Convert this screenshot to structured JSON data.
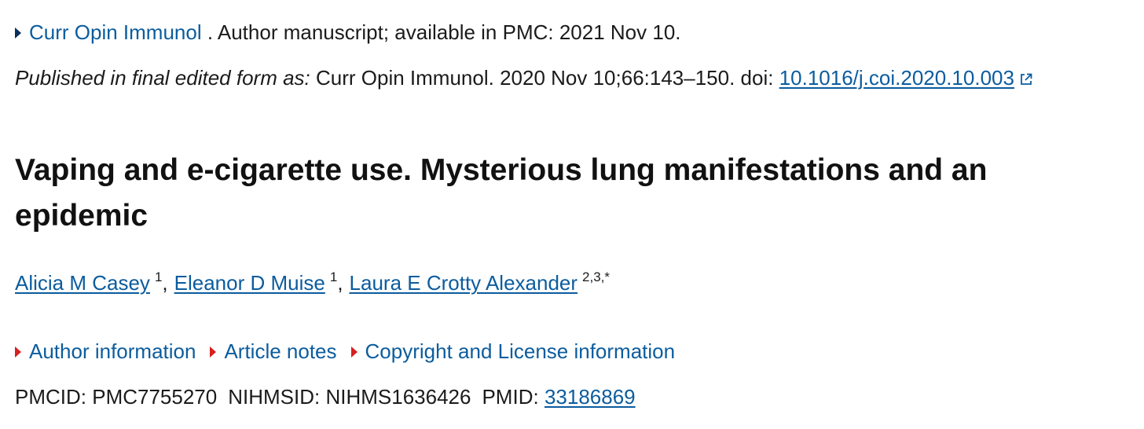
{
  "journal_line": {
    "journal_link": "Curr Opin Immunol",
    "rest": ". Author manuscript; available in PMC: 2021 Nov 10."
  },
  "published_line": {
    "italic_prefix": "Published in final edited form as:",
    "citation": " Curr Opin Immunol. 2020 Nov 10;66:143–150. doi: ",
    "doi_link": "10.1016/j.coi.2020.10.003",
    "external_icon": "external-link-icon"
  },
  "article": {
    "title": "Vaping and e-cigarette use. Mysterious lung manifestations and an epidemic"
  },
  "authors": [
    {
      "name": "Alicia M Casey",
      "sup": "1",
      "sep": ","
    },
    {
      "name": "Eleanor D Muise",
      "sup": "1",
      "sep": ","
    },
    {
      "name": "Laura E Crotty Alexander",
      "sup": "2,3,*",
      "sep": ""
    }
  ],
  "accordions": [
    {
      "label": "Author information"
    },
    {
      "label": "Article notes"
    },
    {
      "label": "Copyright and License information"
    }
  ],
  "ids": {
    "pmcid_label": "PMCID:",
    "pmcid_value": "PMC7755270",
    "nihmsid_label": "NIHMSID:",
    "nihmsid_value": "NIHMS1636426",
    "pmid_label": "PMID:",
    "pmid_value": "33186869"
  },
  "colors": {
    "link": "#0b5c9e",
    "accordion_marker": "#d61f1f",
    "journal_marker": "#0b2f5b"
  }
}
